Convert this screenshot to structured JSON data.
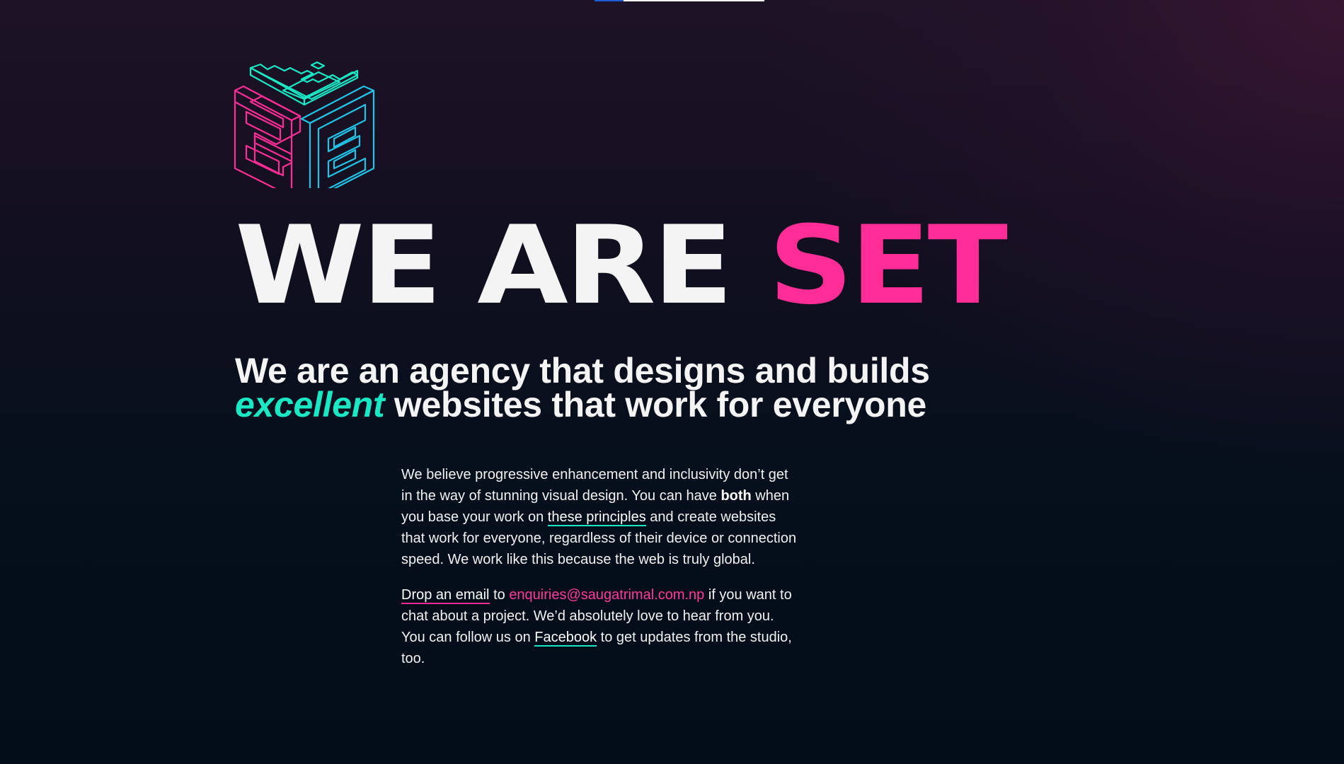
{
  "page": {
    "hero": {
      "prefix": "WE ARE ",
      "accent": "SET"
    },
    "tagline": {
      "line1": "We are an agency that designs and builds",
      "emphasis": "excellent",
      "line2_rest": " websites that work for everyone"
    },
    "intro": {
      "part1": "We believe progressive enhancement and inclusivity don’t get in the way of stunning visual design. You can have ",
      "bold": "both",
      "part2": " when you base your work on ",
      "link_label": "these principles",
      "part3": " and create websites that work for everyone, regardless of their device or connection speed. We work like this because the web is truly global."
    },
    "contact": {
      "link_label": "Drop an email",
      "part1": " to ",
      "email": "enquiries@saugatrimal.com.np",
      "part2": " if you want to chat about a project. We’d absolutely love to hear from you. You can follow us on ",
      "facebook_label": "Facebook",
      "part3": " to get updates from the studio, too."
    },
    "loading_progress": 0.17
  },
  "colors": {
    "accent_pink": "#ff2d95",
    "accent_teal": "#1ae8c4",
    "accent_blue": "#22c3e6",
    "background": "#020d18"
  },
  "icons": {
    "logo": "set-isometric-logo-icon"
  }
}
